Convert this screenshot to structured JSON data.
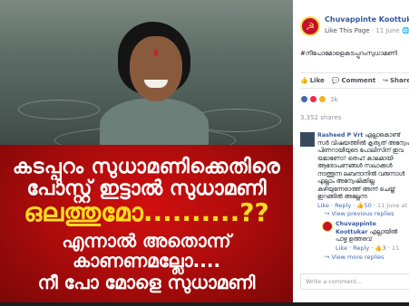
{
  "image": {
    "headline_line1": "കടപ്പുറം സുധാമണിക്കെതിരെ",
    "headline_line2": "പോസ്റ്റ് ഇട്ടാൽ സുധാമണി",
    "headline_line3": "ഒലത്തുമോ..........??",
    "sub_line1": "എന്നാൽ അതൊന്ന്",
    "sub_line2": "കാണണമല്ലോ....",
    "sub_line3": "നീ പോ മോളെ സുധാമണി"
  },
  "post": {
    "page_name": "Chuvappinte Koottukar",
    "like_page": "Like This Page",
    "timestamp": "11 June",
    "hashtag": "#നീപോമോളെകടപ്പുറംസുധാമണി",
    "actions": {
      "like": "Like",
      "comment": "Comment",
      "share": "Share"
    },
    "reaction_count": "3k",
    "shares": "3,352 shares"
  },
  "comments": [
    {
      "author": "Rasheed P Vrt",
      "text": "എല്ലാകൊണ്ട് സർ വിഷയത്തിൽ കൃത്യത് അന്വേഷ പിണറായിയുടെ പോലീസിന് ഇവ യമാണോ? തെഹ് കാലമായി ആരോപണങ്ങൾ സഖാക്കൾ നടത്തുന്ന ലബന്ദാനിൽ വരുന്നാൾ എല്ലാം അന്വേഷിക്കില്ല കഴിയുന്നേരാത്ത് അന്ന് ചെയ്ത് ഇറങ്ങിൽ അല്ലേന്ന",
      "like": "Like",
      "reply": "Reply",
      "likes": "50",
      "time": "11 June at"
    },
    {
      "author": "Chuvappinte Koottukar",
      "text": "എല്ലായിൽ പാഴ്ച ഉത്തരവ്",
      "like": "Like",
      "reply": "Reply",
      "likes": "3",
      "time": "11"
    }
  ],
  "links": {
    "view_previous_replies": "View previous replies",
    "view_more_replies": "View more replies"
  },
  "write_comment_placeholder": "Write a comment..."
}
